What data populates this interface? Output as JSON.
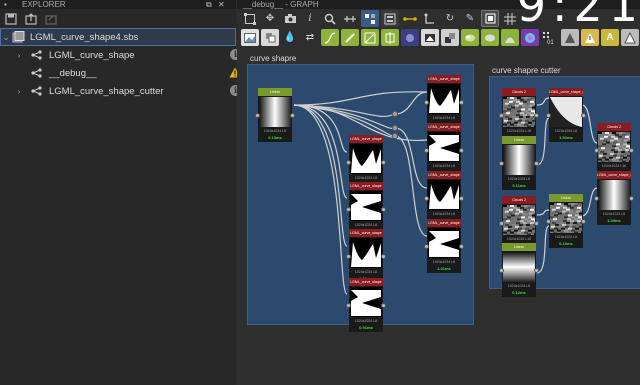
{
  "explorer": {
    "title": "EXPLORER",
    "tree": [
      {
        "label": "LGML_curve_shape4.sbs",
        "expanded": true,
        "selected": true,
        "icon": "package-icon"
      },
      {
        "label": "LGML_curve_shape",
        "expanded": false,
        "icon": "graph-icon",
        "badge": "info-icon"
      },
      {
        "label": "__debug__",
        "expanded": null,
        "icon": "graph-icon",
        "badge": "warning-icon"
      },
      {
        "label": "LGML_curve_shape_cutter",
        "expanded": false,
        "icon": "graph-icon",
        "badge": "info-icon"
      }
    ]
  },
  "graph": {
    "tab_title": "__debug__ - GRAPH",
    "overlay_text": "9:21",
    "frames": [
      {
        "title": "curve shapre"
      },
      {
        "title": "curve shapre cutter"
      }
    ],
    "nodes": [
      {
        "header": "Linear",
        "res": "1024x1024",
        "bits": "L8",
        "time": "0.13ms",
        "header_color": "#7a9a2e",
        "time_color": "#3fe03f"
      },
      {
        "header": "LGML_curve_shape",
        "res": "1024x1024",
        "bits": "L8",
        "time": "1.31ms",
        "header_color": "#8a1c22",
        "time_color": "#3fe03f"
      },
      {
        "header": "LGML_curve_shape",
        "res": "1024x1024",
        "bits": "L8",
        "time": "1.27ms",
        "header_color": "#8a1c22",
        "time_color": "#3fe03f"
      },
      {
        "header": "LGML_curve_shape",
        "res": "1024x1024",
        "bits": "L8",
        "time": "0.98ms",
        "header_color": "#8a1c22",
        "time_color": "#3fe03f"
      },
      {
        "header": "LGML_curve_shape",
        "res": "1024x1024",
        "bits": "L8",
        "time": "1.01ms",
        "header_color": "#8a1c22",
        "time_color": "#3fe03f"
      },
      {
        "header": "LGML_curve_shape",
        "res": "1024x1024",
        "bits": "L8",
        "time": "1.13ms",
        "header_color": "#8a1c22",
        "time_color": "#3fe03f"
      },
      {
        "header": "LGML_curve_shape",
        "res": "1024x1024",
        "bits": "L8",
        "time": "0.94ms",
        "header_color": "#8a1c22",
        "time_color": "#3fe03f"
      },
      {
        "header": "LGML_curve_shape",
        "res": "1024x1024",
        "bits": "L8",
        "time": "1.06ms",
        "header_color": "#8a1c22",
        "time_color": "#3fe03f"
      },
      {
        "header": "LGML_curve_shape",
        "res": "1024x1024",
        "bits": "L8",
        "time": "0.91ms",
        "header_color": "#8a1c22",
        "time_color": "#3fe03f"
      },
      {
        "header": "Clouds 2",
        "res": "1024x1024",
        "bits": "L16",
        "time": "20.51ms",
        "header_color": "#8a1c22",
        "time_color": "#ff4040"
      },
      {
        "header": "LGML_curve_shape_cutter",
        "res": "1024x1024",
        "bits": "L8",
        "time": "1.52ms",
        "header_color": "#8a1c22",
        "time_color": "#3fe03f"
      },
      {
        "header": "Linear",
        "res": "1024x1024",
        "bits": "L8",
        "time": "0.11ms",
        "header_color": "#7a9a2e",
        "time_color": "#3fe03f"
      },
      {
        "header": "Clouds 2",
        "res": "1024x1024",
        "bits": "L16",
        "time": "18.87ms",
        "header_color": "#8a1c22",
        "time_color": "#ff4040"
      },
      {
        "header": "Linear",
        "res": "1024x1024",
        "bits": "L8",
        "time": "0.10ms",
        "header_color": "#7a9a2e",
        "time_color": "#3fe03f"
      },
      {
        "header": "Clouds 2",
        "res": "1024x1024",
        "bits": "L16",
        "time": "19.40ms",
        "header_color": "#8a1c22",
        "time_color": "#ff4040"
      },
      {
        "header": "LGML_curve_shape_cutter",
        "res": "1024x1024",
        "bits": "L8",
        "time": "1.49ms",
        "header_color": "#8a1c22",
        "time_color": "#3fe03f"
      },
      {
        "header": "Linear",
        "res": "1024x1024",
        "bits": "L8",
        "time": "0.12ms",
        "header_color": "#7a9a2e",
        "time_color": "#3fe03f"
      }
    ],
    "toolbar_tools": [
      "frame-icon",
      "move-icon",
      "camera-icon",
      "info-icon",
      "search-icon",
      "link-icon",
      "align-icon",
      "layout-icon",
      "comment-icon",
      "pin-icon",
      "redo-icon",
      "settings-icon",
      "view-icon",
      "grid-icon"
    ],
    "palette_tools": [
      "bitmap-icon",
      "pattern-icon",
      "fill-icon",
      "swap-icon",
      "curve-icon",
      "paint-icon",
      "gradient-icon",
      "transform-icon",
      "blur-icon",
      "levels-icon",
      "blend-icon",
      "noise-icon",
      "grayscale-icon",
      "hsl-icon",
      "channels-icon",
      "number-icon",
      "warp-icon",
      "normal-icon",
      "text-icon",
      "shape-icon",
      "output-icon"
    ],
    "palette_number": "01"
  }
}
